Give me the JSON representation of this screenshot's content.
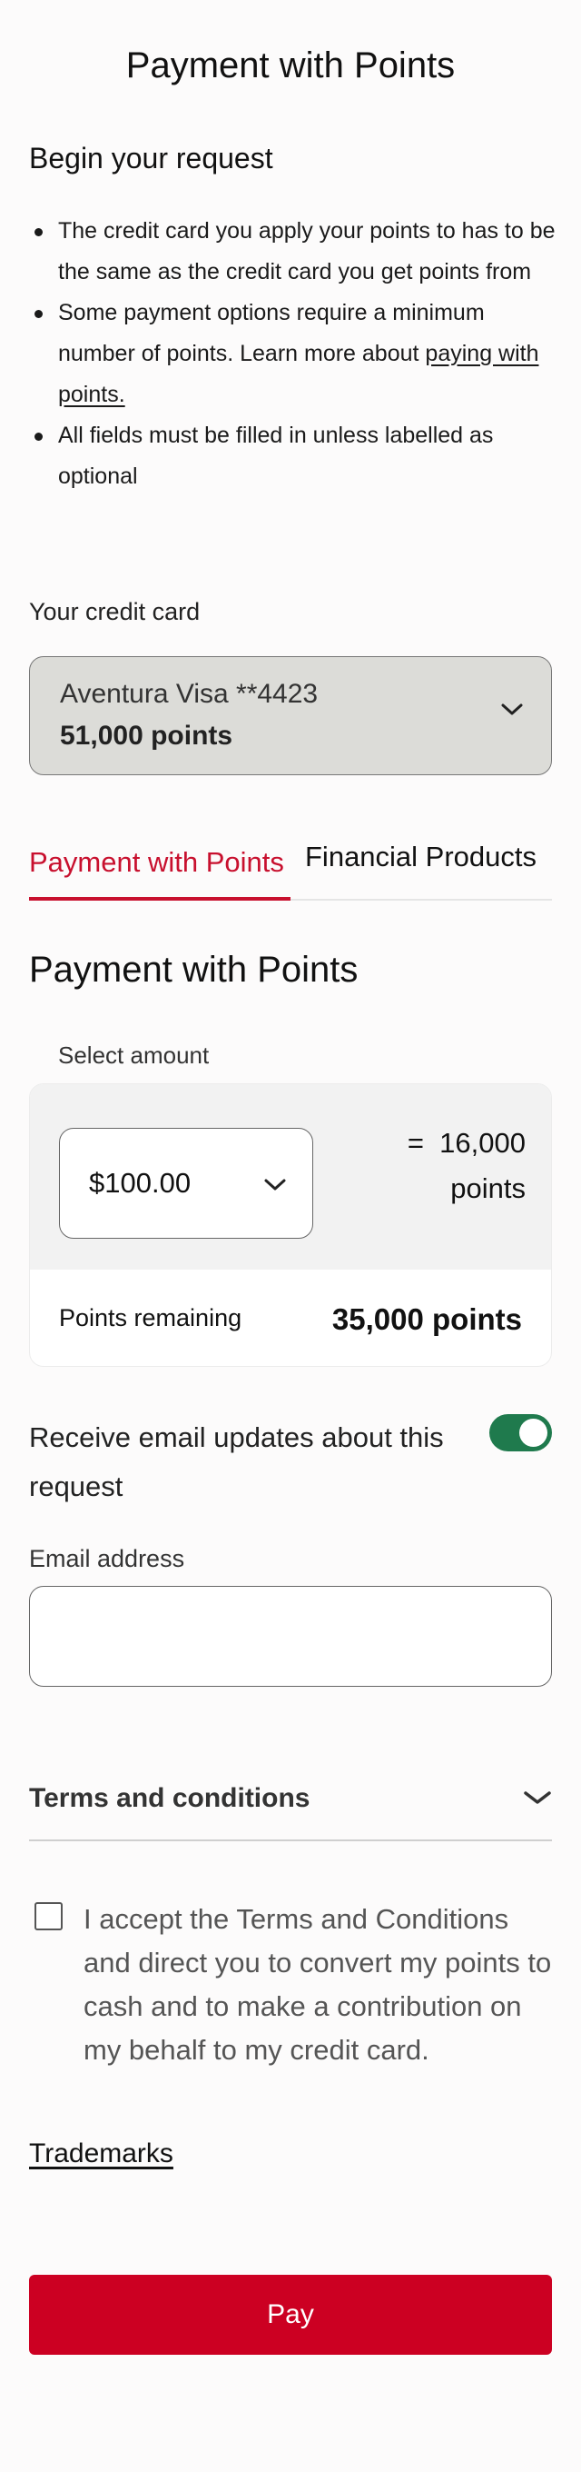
{
  "page": {
    "title": "Payment with Points"
  },
  "intro": {
    "heading": "Begin your request",
    "bullets": [
      {
        "text": "The credit card you apply your points to has to be the same as the credit card you get points from"
      },
      {
        "text_before": "Some payment options require a minimum number of points. Learn more about ",
        "link": "paying with points."
      },
      {
        "text": "All fields must be filled in unless labelled as optional"
      }
    ]
  },
  "credit_card": {
    "label": "Your credit card",
    "selected_name": "Aventura Visa **4423",
    "selected_points": "51,000 points"
  },
  "tabs": [
    {
      "label": "Payment with Points",
      "active": true
    },
    {
      "label": "Financial Products",
      "active": false
    }
  ],
  "section": {
    "title": "Payment with Points"
  },
  "amount": {
    "label": "Select amount",
    "selected_value": "$100.00",
    "equals_symbol": "=",
    "equals_points": "16,000",
    "points_unit": "points",
    "remaining_label": "Points remaining",
    "remaining_value": "35,000 points"
  },
  "email_updates": {
    "label": "Receive email updates about this request",
    "enabled": true
  },
  "email": {
    "label": "Email address",
    "value": "",
    "placeholder": ""
  },
  "terms": {
    "label": "Terms and conditions"
  },
  "accept": {
    "text": "I accept the Terms and Conditions and direct you to convert my points to cash and to make a contribution on my behalf to my credit card.",
    "checked": false
  },
  "links": {
    "trademarks": "Trademarks"
  },
  "actions": {
    "pay_label": "Pay"
  },
  "colors": {
    "brand_red": "#cc0022",
    "tab_active": "#c8102e",
    "toggle_on": "#1f7a4d",
    "card_bg": "#dcdcd8"
  }
}
